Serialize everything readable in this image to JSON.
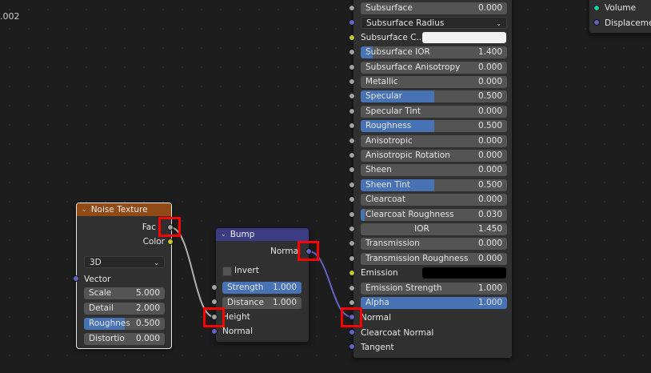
{
  "corner_text": ".002",
  "colors": {
    "noise_header": "#8f4a16",
    "bump_header": "#3c3c84",
    "accent": "#4772b3"
  },
  "noise": {
    "title": "Noise Texture",
    "out_fac": "Fac",
    "out_color": "Color",
    "dimension": "3D",
    "in_vector": "Vector",
    "fields": [
      {
        "label": "Scale",
        "value": "5.000"
      },
      {
        "label": "Detail",
        "value": "2.000"
      },
      {
        "label": "Roughnes",
        "value": "0.500",
        "fill": 0.5
      },
      {
        "label": "Distortio",
        "value": "0.000"
      }
    ]
  },
  "bump": {
    "title": "Bump",
    "out_normal": "Normal",
    "invert": "Invert",
    "fields": [
      {
        "label": "Strength",
        "value": "1.000",
        "fill": 1.0
      },
      {
        "label": "Distance",
        "value": "1.000"
      }
    ],
    "in_height": "Height",
    "in_normal": "Normal"
  },
  "bsdf": {
    "rows": [
      {
        "label": "Subsurface",
        "value": "0.000"
      },
      {
        "label": "Subsurface Radius",
        "type": "dropdown"
      },
      {
        "label": "Subsurface C...",
        "type": "color",
        "color": "#f2f2f2"
      },
      {
        "label": "Subsurface IOR",
        "value": "1.400",
        "fill": 0.08
      },
      {
        "label": "Subsurface Anisotropy",
        "value": "0.000"
      },
      {
        "label": "Metallic",
        "value": "0.000"
      },
      {
        "label": "Specular",
        "value": "0.500",
        "fill": 0.5
      },
      {
        "label": "Specular Tint",
        "value": "0.000"
      },
      {
        "label": "Roughness",
        "value": "0.500",
        "fill": 0.5
      },
      {
        "label": "Anisotropic",
        "value": "0.000"
      },
      {
        "label": "Anisotropic Rotation",
        "value": "0.000"
      },
      {
        "label": "Sheen",
        "value": "0.000"
      },
      {
        "label": "Sheen Tint",
        "value": "0.500",
        "fill": 0.5
      },
      {
        "label": "Clearcoat",
        "value": "0.000"
      },
      {
        "label": "Clearcoat Roughness",
        "value": "0.030",
        "fill": 0.03
      },
      {
        "label": "IOR",
        "value": "1.450",
        "centered": true
      },
      {
        "label": "Transmission",
        "value": "0.000"
      },
      {
        "label": "Transmission Roughness",
        "value": "0.000"
      },
      {
        "label": "Emission",
        "type": "color",
        "color": "#000000"
      },
      {
        "label": "Emission Strength",
        "value": "1.000"
      },
      {
        "label": "Alpha",
        "value": "1.000",
        "fill": 1.0
      }
    ],
    "in_normal": "Normal",
    "in_clearcoat_normal": "Clearcoat Normal",
    "in_tangent": "Tangent"
  },
  "output": {
    "volume": "Volume",
    "displacement": "Displacement"
  }
}
